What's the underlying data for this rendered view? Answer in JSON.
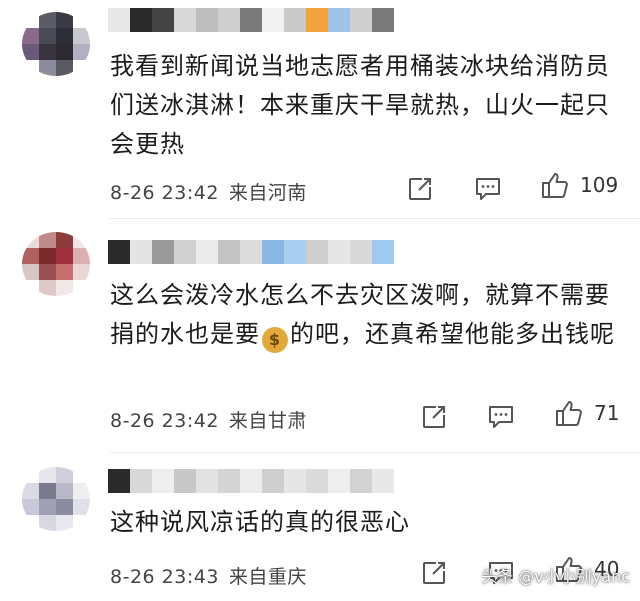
{
  "comments": [
    {
      "avatar_colors": [
        "#ffffff",
        "#5c5c66",
        "#3a3a44",
        "#ffffff",
        "#8a6a8a",
        "#4a4a54",
        "#2e2e38",
        "#c8c8d0",
        "#6a5a7a",
        "#3a3440",
        "#2a2a30",
        "#b0b0c0",
        "#ffffff",
        "#8c8c9c",
        "#5a5a64",
        "#ffffff"
      ],
      "username_colors": [
        "#e8e8e8",
        "#2a2a2a",
        "#444444",
        "#d8d8d8",
        "#bdbdbd",
        "#cfcfcf",
        "#7a7a7a",
        "#f2f2f2",
        "#c9c9c9",
        "#f2a43c",
        "#9fc3e8",
        "#cfcfcf",
        "#7a7a7a"
      ],
      "text": "我看到新闻说当地志愿者用桶装冰块给消防员们送冰淇淋！本来重庆干旱就热，山火一起只会更热",
      "time": "8-26 23:42",
      "location": "来自河南",
      "likes": "109"
    },
    {
      "avatar_colors": [
        "#eadada",
        "#c08a8a",
        "#8c3a3a",
        "#f0e4e4",
        "#b06060",
        "#7a2a2a",
        "#a03040",
        "#dcb0b0",
        "#d6c6c6",
        "#9a5050",
        "#c87070",
        "#ead6d6",
        "#ffffff",
        "#e0c8c8",
        "#f2e8e8",
        "#ffffff"
      ],
      "username_colors": [
        "#2a2a2a",
        "#e4e4e4",
        "#9a9a9a",
        "#d0d0d0",
        "#eaeaea",
        "#c4c4c4",
        "#dcdcdc",
        "#8ab8e4",
        "#a8cff0",
        "#cfcfcf",
        "#e6e6e6",
        "#d8d8d8",
        "#9fc9ee"
      ],
      "text_before_icon": "这么会泼冷水怎么不去灾区泼啊，就算不需要捐的水也是要",
      "money_icon": "money-bag",
      "text_after_icon": "的吧，还真希望他能多出钱呢",
      "time": "8-26 23:42",
      "location": "来自甘肃",
      "likes": "71"
    },
    {
      "avatar_colors": [
        "#ffffff",
        "#e6e6ec",
        "#d0d0dc",
        "#ffffff",
        "#dadae4",
        "#7a7a8c",
        "#b8b8c8",
        "#eeeeee",
        "#c8c8d8",
        "#a0a0b4",
        "#8c8ca0",
        "#e0e0e8",
        "#ffffff",
        "#d8d8e2",
        "#e8e8ee",
        "#ffffff"
      ],
      "username_colors": [
        "#2a2a2a",
        "#d8d8d8",
        "#eeeeee",
        "#c8c8c8",
        "#e2e2e2",
        "#d4d4d4",
        "#ececec",
        "#cfcfcf",
        "#e6e6e6",
        "#dadada",
        "#eeeeee",
        "#d2d2d2",
        "#e8e8e8"
      ],
      "text": "这种说风凉话的真的很恶心",
      "time": "8-26 23:43",
      "location": "来自重庆",
      "likes": "40"
    }
  ],
  "watermark": "头条 @v小小别yanc",
  "icons": {
    "share": "share-icon",
    "comment": "comment-icon",
    "like": "thumbs-up-icon"
  }
}
